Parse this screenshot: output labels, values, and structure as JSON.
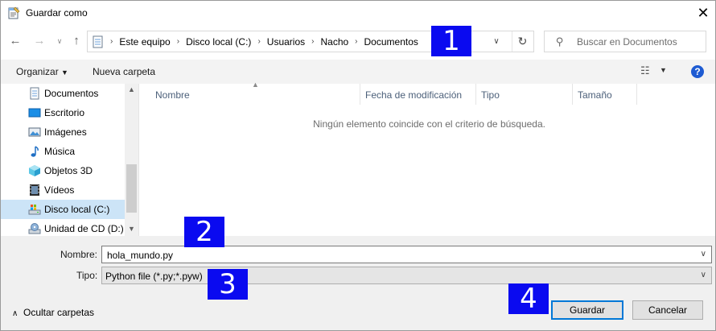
{
  "window": {
    "title": "Guardar como"
  },
  "address": {
    "crumbs": [
      "Este equipo",
      "Disco local (C:)",
      "Usuarios",
      "Nacho",
      "Documentos"
    ]
  },
  "search": {
    "placeholder": "Buscar en Documentos"
  },
  "toolbar": {
    "organize_label": "Organizar",
    "new_folder_label": "Nueva carpeta",
    "help_label": "?"
  },
  "nav_pane": {
    "items": [
      {
        "label": "Documentos",
        "icon": "documents-icon"
      },
      {
        "label": "Escritorio",
        "icon": "desktop-icon"
      },
      {
        "label": "Imágenes",
        "icon": "pictures-icon"
      },
      {
        "label": "Música",
        "icon": "music-icon"
      },
      {
        "label": "Objetos 3D",
        "icon": "objects-3d-icon"
      },
      {
        "label": "Vídeos",
        "icon": "videos-icon"
      },
      {
        "label": "Disco local (C:)",
        "icon": "local-disk-icon",
        "selected": true
      },
      {
        "label": "Unidad de CD (D:) (",
        "icon": "cd-drive-icon"
      }
    ]
  },
  "file_list": {
    "columns": [
      "Nombre",
      "Fecha de modificación",
      "Tipo",
      "Tamaño"
    ],
    "empty_message": "Ningún elemento coincide con el criterio de búsqueda."
  },
  "save_form": {
    "name_label": "Nombre:",
    "name_value": "hola_mundo.py",
    "type_label": "Tipo:",
    "type_value": "Python file (*.py;*.pyw)",
    "hide_folders_label": "Ocultar carpetas",
    "save_label": "Guardar",
    "cancel_label": "Cancelar"
  },
  "callouts": [
    "1",
    "2",
    "3",
    "4"
  ],
  "colors": {
    "accent": "#0078d7",
    "callout": "#0a0af0",
    "selection": "#cce4f7",
    "help": "#1e5bd2"
  }
}
